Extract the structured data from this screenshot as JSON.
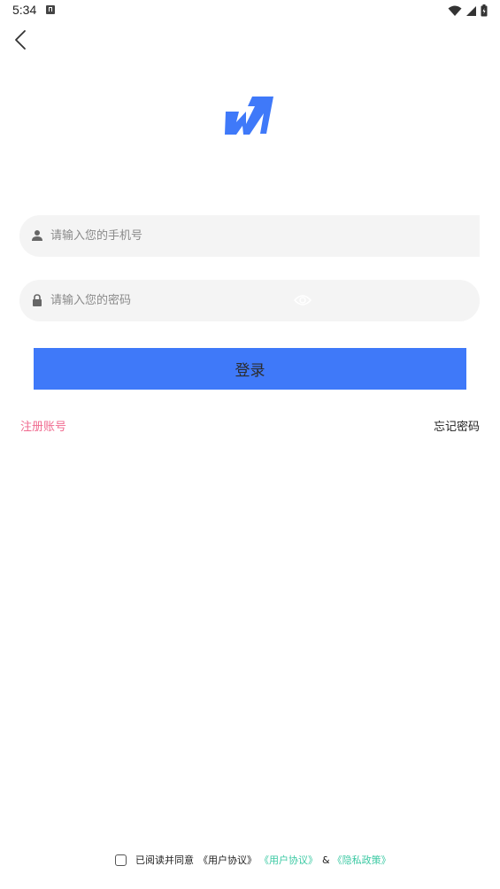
{
  "status_bar": {
    "time": "5:34",
    "icons": [
      "notification-icon",
      "wifi-icon",
      "signal-icon",
      "battery-icon"
    ]
  },
  "back_icon": "back-arrow-icon",
  "logo_color": "#3f79f9",
  "phone": {
    "placeholder": "请输入您的手机号",
    "value": "",
    "icon": "user-icon"
  },
  "password": {
    "placeholder": "请输入您的密码",
    "value": "",
    "icon": "lock-icon",
    "toggle_icon": "eye-icon"
  },
  "login": {
    "label": "登录",
    "color": "#3f79f9"
  },
  "links": {
    "register": "注册账号",
    "register_color": "#f06a8f",
    "forgot": "忘记密码"
  },
  "agreement": {
    "checked": false,
    "text": "已阅读并同意",
    "plain_label": "《用户协议》",
    "user_agreement": "《用户协议》",
    "amp": "&",
    "privacy_policy": "《隐私政策》",
    "link_color": "#3bc9a3"
  }
}
